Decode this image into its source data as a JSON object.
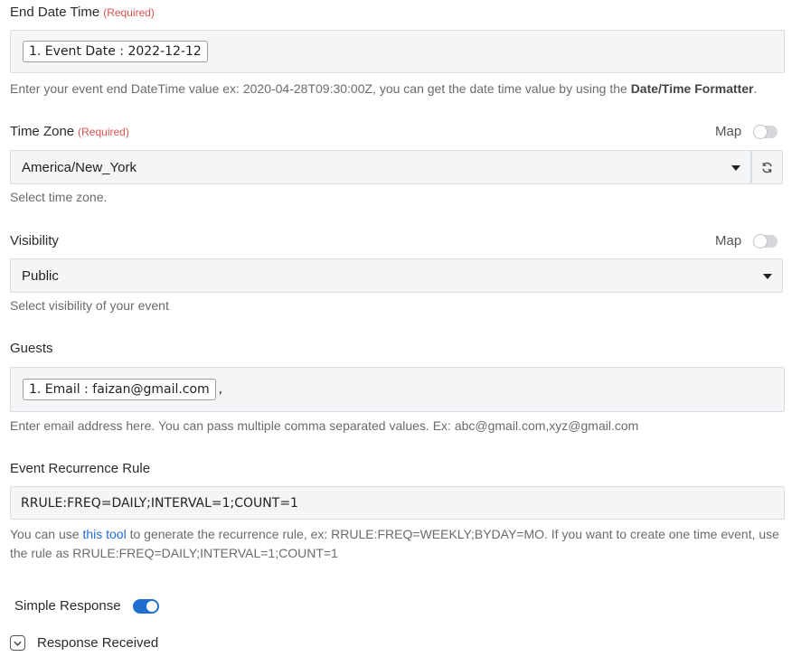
{
  "end_date_time": {
    "label": "End Date Time",
    "required": "(Required)",
    "chip": "1. Event Date : 2022-12-12",
    "help_prefix": "Enter your event end DateTime value ex: 2020-04-28T09:30:00Z, you can get the date time value by using the ",
    "help_bold": "Date/Time Formatter",
    "help_suffix": "."
  },
  "time_zone": {
    "label": "Time Zone",
    "required": "(Required)",
    "map_label": "Map",
    "value": "America/New_York",
    "help": "Select time zone."
  },
  "visibility": {
    "label": "Visibility",
    "map_label": "Map",
    "value": "Public",
    "help": "Select visibility of your event"
  },
  "guests": {
    "label": "Guests",
    "chip": "1. Email : faizan@gmail.com",
    "separator": ",",
    "help": "Enter email address here. You can pass multiple comma separated values. Ex: abc@gmail.com,xyz@gmail.com"
  },
  "recurrence": {
    "label": "Event Recurrence Rule",
    "value": "RRULE:FREQ=DAILY;INTERVAL=1;COUNT=1",
    "help_prefix": "You can use ",
    "help_link": "this tool",
    "help_suffix": " to generate the recurrence rule, ex: RRULE:FREQ=WEEKLY;BYDAY=MO. If you want to create one time event, use the rule as RRULE:FREQ=DAILY;INTERVAL=1;COUNT=1"
  },
  "simple_response": {
    "label": "Simple Response",
    "enabled": true
  },
  "response_received": {
    "label": "Response Received"
  },
  "colors": {
    "accent": "#1f6fd1",
    "required": "#d9534f",
    "field_bg": "#f3f5f7"
  },
  "icons": [
    "refresh-icon",
    "caret-down-icon",
    "chevron-down-icon"
  ]
}
